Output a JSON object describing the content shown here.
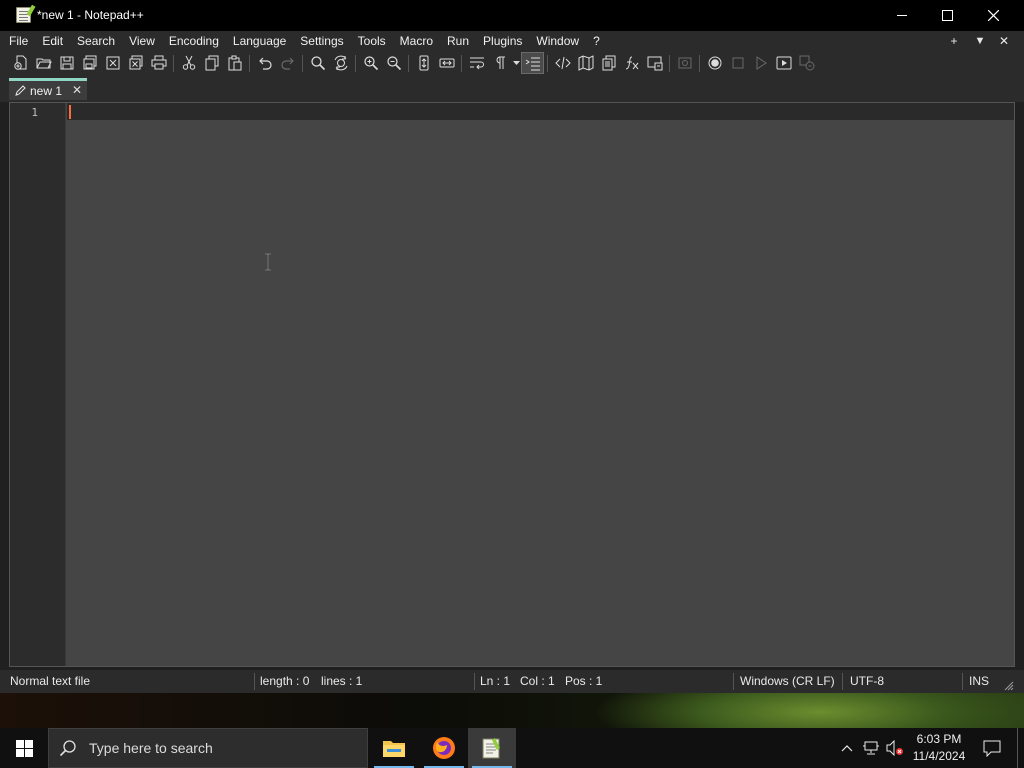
{
  "window": {
    "title": "*new 1 - Notepad++",
    "controls": {
      "minimize": "minimize-icon",
      "maximize": "maximize-icon",
      "close": "close-icon"
    }
  },
  "menu": {
    "items": [
      "File",
      "Edit",
      "Search",
      "View",
      "Encoding",
      "Language",
      "Settings",
      "Tools",
      "Macro",
      "Run",
      "Plugins",
      "Window",
      "?"
    ],
    "right_controls": {
      "add": "+",
      "dropdown": "▼",
      "close": "✕"
    }
  },
  "toolbar": {
    "icons": [
      "new-file-icon",
      "open-file-icon",
      "save-icon",
      "save-all-icon",
      "close-icon",
      "close-all-icon",
      "print-icon",
      "cut-icon",
      "copy-icon",
      "paste-icon",
      "undo-icon",
      "redo-icon",
      "find-icon",
      "replace-icon",
      "zoom-in-icon",
      "zoom-out-icon",
      "sync-vertical-icon",
      "sync-horizontal-icon",
      "word-wrap-icon",
      "show-all-characters-icon",
      "indent-guide-icon",
      "xml-tag-icon",
      "document-map-icon",
      "document-list-icon",
      "function-list-icon",
      "folder-workspace-icon",
      "monitoring-icon",
      "record-macro-icon",
      "stop-recording-icon",
      "play-macro-icon",
      "run-macro-multiple-icon",
      "save-macro-icon"
    ]
  },
  "tab": {
    "label": "new 1",
    "icon": "pencil-icon",
    "close": "✕"
  },
  "editor": {
    "line_numbers": [
      "1"
    ],
    "content": ""
  },
  "status": {
    "file_type": "Normal text file",
    "length": "length : 0",
    "lines": "lines : 1",
    "ln": "Ln : 1",
    "col": "Col : 1",
    "pos": "Pos : 1",
    "eol": "Windows (CR LF)",
    "encoding": "UTF-8",
    "mode": "INS"
  },
  "taskbar": {
    "search_placeholder": "Type here to search",
    "apps": [
      "file-explorer-icon",
      "firefox-icon",
      "notepad-plus-plus-icon"
    ],
    "time": "6:03 PM",
    "date": "11/4/2024"
  },
  "colors": {
    "accent_tab": "#8fd6c4",
    "caret": "#ff6b3d",
    "editor_bg": "#454545",
    "title_bg": "#000000"
  }
}
